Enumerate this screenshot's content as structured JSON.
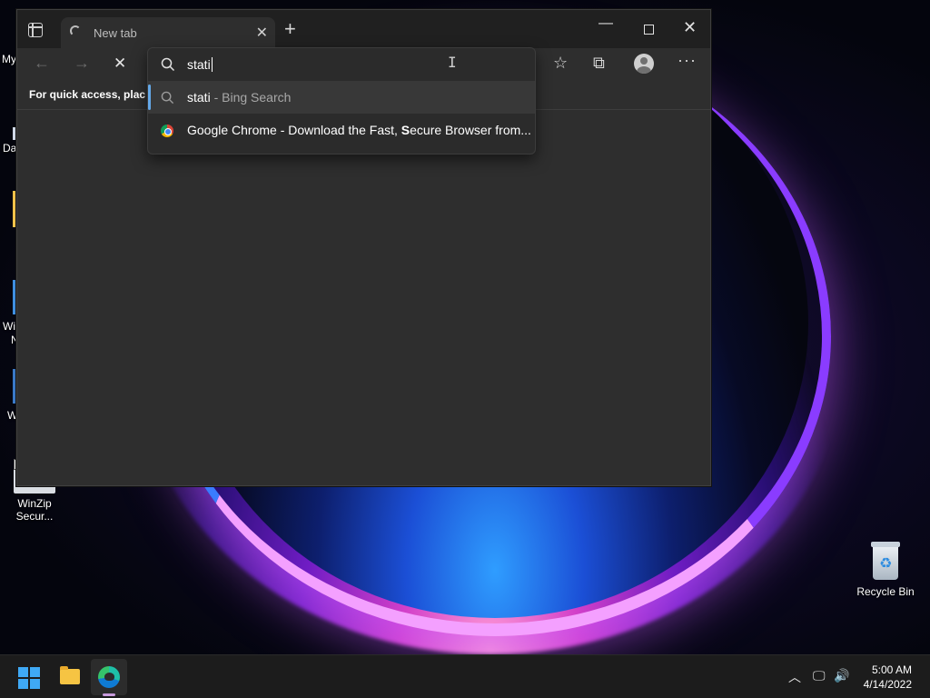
{
  "desktop": {
    "recycle_bin_label": "Recycle Bin",
    "winzip_label_line1": "WinZip",
    "winzip_label_line2": "Secur...",
    "partial_labels": [
      "My",
      "Da",
      "Wi",
      "N",
      "W"
    ]
  },
  "browser": {
    "tab_title": "New tab",
    "favorites_hint": "For quick access, place y",
    "address_typed": "stati",
    "suggestions": [
      {
        "main": "stati",
        "sub": " - Bing Search"
      },
      {
        "pre": "Google Chrome - Download the Fast, ",
        "bold": "S",
        "post": "ecure Browser from..."
      }
    ]
  },
  "taskbar": {
    "time": "5:00 AM",
    "date": "4/14/2022"
  },
  "icons": {
    "tab_actions": "tab-actions-icon",
    "new_tab": "plus-icon",
    "back": "arrow-left-icon",
    "forward": "arrow-right-icon",
    "stop": "close-icon",
    "favorites": "star-icon",
    "collections": "collections-icon",
    "profile": "avatar-icon",
    "more": "ellipsis-icon",
    "search": "search-icon",
    "chrome": "chrome-icon"
  },
  "colors": {
    "accent": "#64a8e8",
    "start": "#3fa9f5"
  }
}
